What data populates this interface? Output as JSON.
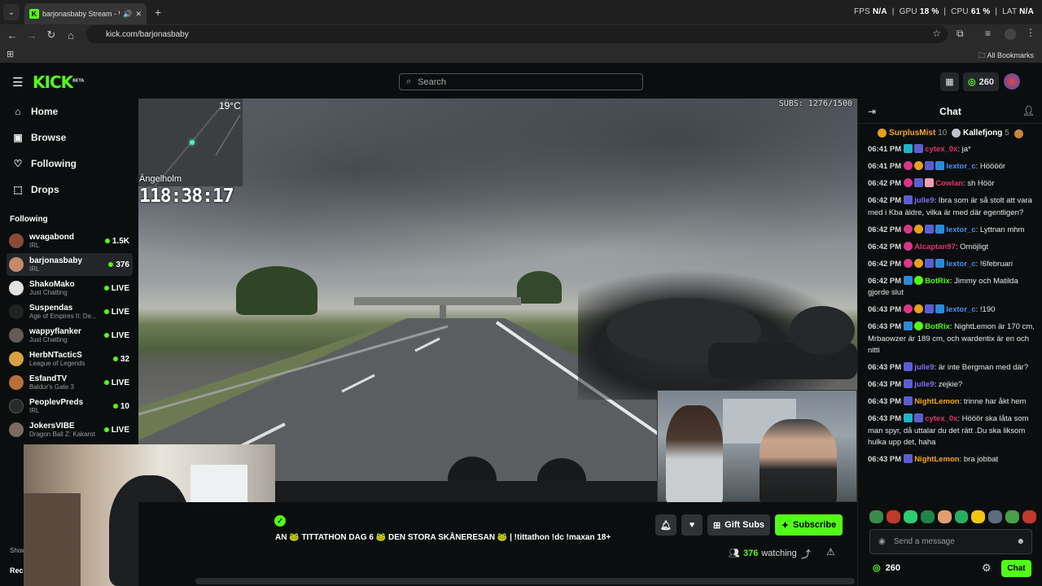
{
  "browser": {
    "tab_title": "barjonasbaby Stream - Wat",
    "url": "kick.com/barjonasbaby",
    "bookmarks_label": "All Bookmarks",
    "perf": {
      "fps_label": "FPS",
      "fps": "N/A",
      "gpu_label": "GPU",
      "gpu": "18 %",
      "cpu_label": "CPU",
      "cpu": "61 %",
      "lat_label": "LAT",
      "lat": "N/A"
    }
  },
  "header": {
    "logo": "KICK",
    "logo_beta": "BETA",
    "search_placeholder": "Search",
    "coins": "260"
  },
  "sidebar": {
    "nav": [
      {
        "label": "Home",
        "icon": "home-icon"
      },
      {
        "label": "Browse",
        "icon": "browse-icon"
      },
      {
        "label": "Following",
        "icon": "heart-icon"
      },
      {
        "label": "Drops",
        "icon": "drops-icon"
      }
    ],
    "following_label": "Following",
    "following": [
      {
        "name": "wvagabond",
        "category": "IRL",
        "count": "1.5K"
      },
      {
        "name": "barjonasbaby",
        "category": "IRL",
        "count": "376"
      },
      {
        "name": "ShakoMako",
        "category": "Just Chatting",
        "count": "LIVE"
      },
      {
        "name": "Suspendas",
        "category": "Age of Empires II: De...",
        "count": "LIVE"
      },
      {
        "name": "wappyflanker",
        "category": "Just Chatting",
        "count": "LIVE"
      },
      {
        "name": "HerbNTacticS",
        "category": "League of Legends",
        "count": "32"
      },
      {
        "name": "EsfandTV",
        "category": "Baldur's Gate 3",
        "count": "LIVE"
      },
      {
        "name": "PeoplevPreds",
        "category": "IRL",
        "count": "10"
      },
      {
        "name": "JokersVIBE",
        "category": "Dragon Ball Z: Kakarot",
        "count": "LIVE"
      }
    ],
    "show_more": "Show",
    "recommended": "Rec"
  },
  "video": {
    "temperature": "19°C",
    "city": "Ängelholm",
    "timer": "118:38:17",
    "subs": "SUBS: 1276/1500"
  },
  "stream": {
    "title": "AN 🐸 TITTATHON DAG 6 🐸 DEN STORA SKÅNERESAN 🐸 | !tittathon !dc !maxan 18+",
    "gift_label": "Gift Subs",
    "subscribe_label": "Subscribe",
    "watching_count": "376",
    "watching_label": "watching"
  },
  "chat": {
    "title": "Chat",
    "gifters": [
      {
        "name": "SurplusMist",
        "count": "10"
      },
      {
        "name": "Kallefjong",
        "count": "5"
      }
    ],
    "messages": [
      {
        "time": "06:41 PM",
        "user": "cytex_0x",
        "color": "#e0356d",
        "text": "ja*"
      },
      {
        "time": "06:41 PM",
        "user": "lextor_c",
        "color": "#4a8ff0",
        "text": "Höööör"
      },
      {
        "time": "06:42 PM",
        "user": "Cowlan",
        "color": "#e0356d",
        "text": "sh Höör"
      },
      {
        "time": "06:42 PM",
        "user": "julle9",
        "color": "#8a6cf0",
        "text": "Ibra som är så stolt att vara med i Kba äldre, vilka är med där egentligen?"
      },
      {
        "time": "06:42 PM",
        "user": "lextor_c",
        "color": "#4a8ff0",
        "text": "Lyttnan mhm"
      },
      {
        "time": "06:42 PM",
        "user": "Alcaptan97",
        "color": "#e0356d",
        "text": "Omöjligt"
      },
      {
        "time": "06:42 PM",
        "user": "lextor_c",
        "color": "#4a8ff0",
        "text": "!6februari"
      },
      {
        "time": "06:42 PM",
        "user": "BotRix",
        "color": "#53fc18",
        "text": "Jimmy och Matilda gjorde slut"
      },
      {
        "time": "06:43 PM",
        "user": "lextor_c",
        "color": "#4a8ff0",
        "text": "!190"
      },
      {
        "time": "06:43 PM",
        "user": "BotRix",
        "color": "#53fc18",
        "text": "NightLemon är 170 cm, Mrbaowzer är 189 cm, och wardentix är en och nitti"
      },
      {
        "time": "06:43 PM",
        "user": "julle9",
        "color": "#8a6cf0",
        "text": "är inte Bergman med där?"
      },
      {
        "time": "06:43 PM",
        "user": "julle9",
        "color": "#8a6cf0",
        "text": "zejkie?"
      },
      {
        "time": "06:43 PM",
        "user": "NightLemon",
        "color": "#f5a623",
        "text": "trinne har åkt hem"
      },
      {
        "time": "06:43 PM",
        "user": "cytex_0x",
        "color": "#e0356d",
        "text": "Hööör ska låta som man spyr, då uttalar du det rätt .Du ska liksom hulka upp det, haha"
      },
      {
        "time": "06:43 PM",
        "user": "NightLemon",
        "color": "#f5a623",
        "text": "bra jobbat"
      }
    ],
    "input_placeholder": "Send a message",
    "coins": "260",
    "chat_button": "Chat"
  }
}
